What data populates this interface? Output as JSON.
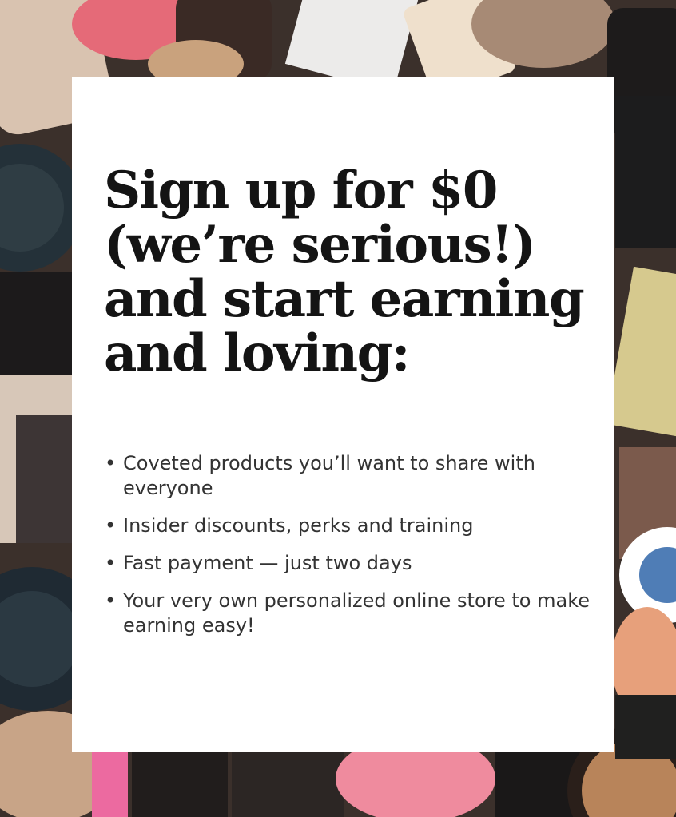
{
  "card": {
    "headline_lines": [
      "Sign up for $0",
      "(we’re serious!)",
      "and start earning",
      "and loving:"
    ],
    "bullet_glyph": "•",
    "benefits": [
      "Coveted products you’ll want to share with everyone",
      "Insider discounts, perks and training",
      "Fast payment — just two days",
      "Your very own personalized online store to make earning easy!"
    ]
  },
  "colors": {
    "card_background": "#ffffff",
    "headline": "#141414",
    "body_text": "#333333"
  },
  "background_icons": [
    "makeup-compact-icon",
    "lipstick-icon",
    "beauty-sponge-icon",
    "foundation-bottle-icon"
  ]
}
